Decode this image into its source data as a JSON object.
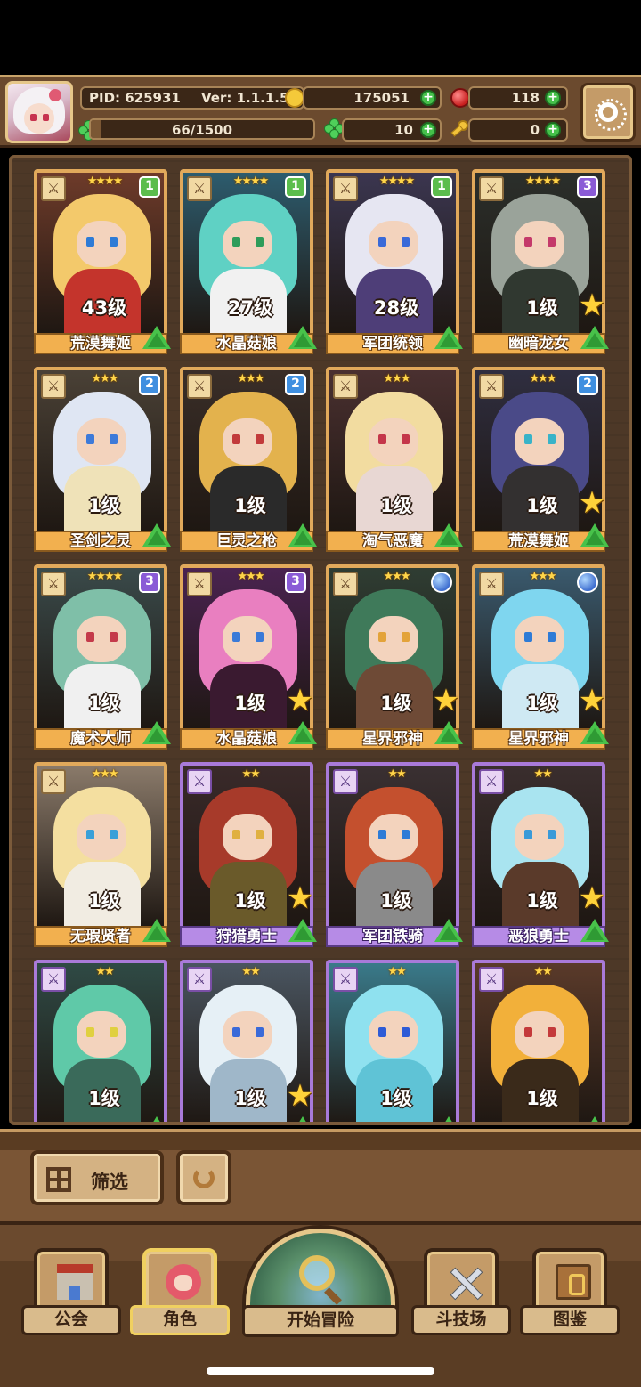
{
  "header": {
    "pid": "PID: 625931",
    "version": "Ver: 1.1.1.5",
    "gold": "175051",
    "gems": "118",
    "stamina": "66/1500",
    "stamina_fraction": 0.044,
    "clovers": "10",
    "keys": "0"
  },
  "cards": [
    {
      "name": "荒漠舞姬",
      "level": "43级",
      "stars": "★★★★",
      "tier": "1",
      "tier_type": "green",
      "frame": "gold",
      "star_badge": false,
      "palette": {
        "bg": "#6e3b2a",
        "hair": "#f3c96b",
        "body": "#c4342c",
        "eye": "#2e7bd6"
      }
    },
    {
      "name": "水晶菇娘",
      "level": "27级",
      "stars": "★★★★",
      "tier": "1",
      "tier_type": "green",
      "frame": "gold",
      "star_badge": false,
      "palette": {
        "bg": "#2d5c6e",
        "hair": "#5fd1c4",
        "body": "#f1f1f1",
        "eye": "#2e9c5a"
      }
    },
    {
      "name": "军团统领",
      "level": "28级",
      "stars": "★★★★",
      "tier": "1",
      "tier_type": "green",
      "frame": "gold",
      "star_badge": false,
      "palette": {
        "bg": "#3b3650",
        "hair": "#e6e6f2",
        "body": "#4e3e78",
        "eye": "#3a6ad8"
      }
    },
    {
      "name": "幽暗龙女",
      "level": "1级",
      "stars": "★★★★",
      "tier": "3",
      "tier_type": "purple",
      "frame": "gold",
      "star_badge": true,
      "palette": {
        "bg": "#2b2f2b",
        "hair": "#9aa39a",
        "body": "#303830",
        "eye": "#c43a6a"
      }
    },
    {
      "name": "圣剑之灵",
      "level": "1级",
      "stars": "★★★",
      "tier": "2",
      "tier_type": "blue",
      "frame": "gold",
      "star_badge": false,
      "palette": {
        "bg": "#4a4136",
        "hair": "#dfe6f3",
        "body": "#efe2b8",
        "eye": "#3d7ad9"
      }
    },
    {
      "name": "巨灵之枪",
      "level": "1级",
      "stars": "★★★",
      "tier": "2",
      "tier_type": "blue",
      "frame": "gold",
      "star_badge": false,
      "palette": {
        "bg": "#3a2e28",
        "hair": "#e3b24d",
        "body": "#2a2a2a",
        "eye": "#c23a3a"
      }
    },
    {
      "name": "淘气恶魔",
      "level": "1级",
      "stars": "★★★",
      "tier": "",
      "tier_type": "none",
      "frame": "gold",
      "star_badge": false,
      "palette": {
        "bg": "#4a3030",
        "hair": "#f2dca0",
        "body": "#e8d7d3",
        "eye": "#c4364a"
      }
    },
    {
      "name": "荒漠舞姬",
      "level": "1级",
      "stars": "★★★",
      "tier": "2",
      "tier_type": "blue",
      "frame": "gold",
      "star_badge": true,
      "palette": {
        "bg": "#2f2e40",
        "hair": "#4a4a88",
        "body": "#333030",
        "eye": "#39b3c8"
      }
    },
    {
      "name": "魔术大师",
      "level": "1级",
      "stars": "★★★★",
      "tier": "3",
      "tier_type": "purple",
      "frame": "gold",
      "star_badge": false,
      "palette": {
        "bg": "#3a4a4a",
        "hair": "#7fbfa8",
        "body": "#f0f0f0",
        "eye": "#c43a4a"
      }
    },
    {
      "name": "水晶菇娘",
      "level": "1级",
      "stars": "★★★",
      "tier": "3",
      "tier_type": "purple",
      "frame": "gold",
      "star_badge": true,
      "palette": {
        "bg": "#4a2350",
        "hair": "#e97fc0",
        "body": "#3a1a30",
        "eye": "#3a7ad8"
      }
    },
    {
      "name": "星界邪神",
      "level": "1级",
      "stars": "★★★",
      "tier": "",
      "tier_type": "orb",
      "frame": "gold",
      "star_badge": true,
      "palette": {
        "bg": "#2f3d33",
        "hair": "#3f7a5a",
        "body": "#6e4a36",
        "eye": "#e3a33a"
      }
    },
    {
      "name": "星界邪神",
      "level": "1级",
      "stars": "★★★",
      "tier": "",
      "tier_type": "orb",
      "frame": "gold",
      "star_badge": true,
      "palette": {
        "bg": "#3a5a6e",
        "hair": "#7fd6ef",
        "body": "#cfe9f3",
        "eye": "#2e7bd6"
      }
    },
    {
      "name": "无瑕贤者",
      "level": "1级",
      "stars": "★★★",
      "tier": "",
      "tier_type": "none",
      "frame": "gold",
      "star_badge": false,
      "palette": {
        "bg": "#8a7a6a",
        "hair": "#f4dfa0",
        "body": "#f1ece2",
        "eye": "#3aa0d8"
      }
    },
    {
      "name": "狩猎勇士",
      "level": "1级",
      "stars": "★★",
      "tier": "",
      "tier_type": "none",
      "frame": "purple",
      "star_badge": true,
      "palette": {
        "bg": "#3a2a2a",
        "hair": "#a73a2a",
        "body": "#6a5a2a",
        "eye": "#e0b040"
      }
    },
    {
      "name": "军团铁骑",
      "level": "1级",
      "stars": "★★",
      "tier": "",
      "tier_type": "none",
      "frame": "purple",
      "star_badge": false,
      "palette": {
        "bg": "#3a3032",
        "hair": "#c4502e",
        "body": "#8a8a8a",
        "eye": "#2e7bd6"
      }
    },
    {
      "name": "恶狼勇士",
      "level": "1级",
      "stars": "★★",
      "tier": "",
      "tier_type": "none",
      "frame": "purple",
      "star_badge": true,
      "palette": {
        "bg": "#3a2e2e",
        "hair": "#a9e4f0",
        "body": "#5a3a2a",
        "eye": "#3a9ad8"
      }
    },
    {
      "name": "",
      "level": "1级",
      "stars": "★★",
      "tier": "",
      "tier_type": "none",
      "frame": "purple",
      "star_badge": false,
      "palette": {
        "bg": "#2f4a45",
        "hair": "#5fc9a8",
        "body": "#3a6a5a",
        "eye": "#e0d040"
      }
    },
    {
      "name": "",
      "level": "1级",
      "stars": "★★",
      "tier": "",
      "tier_type": "none",
      "frame": "purple",
      "star_badge": true,
      "palette": {
        "bg": "#4a5560",
        "hair": "#e6f0f6",
        "body": "#9fb7c9",
        "eye": "#3a6ad8"
      }
    },
    {
      "name": "",
      "level": "1级",
      "stars": "★★",
      "tier": "",
      "tier_type": "none",
      "frame": "purple",
      "star_badge": false,
      "palette": {
        "bg": "#3a7a8a",
        "hair": "#8fe1ef",
        "body": "#5fc3d6",
        "eye": "#2e5bd6"
      }
    },
    {
      "name": "",
      "level": "1级",
      "stars": "★★",
      "tier": "",
      "tier_type": "none",
      "frame": "purple",
      "star_badge": false,
      "palette": {
        "bg": "#5a3a2a",
        "hair": "#f2b03a",
        "body": "#3a2a1a",
        "eye": "#c43a3a"
      }
    }
  ],
  "toolbar": {
    "filter_label": "筛选"
  },
  "nav": {
    "guild": "公会",
    "role": "角色",
    "adventure": "开始冒险",
    "arena": "斗技场",
    "codex": "图鉴"
  }
}
